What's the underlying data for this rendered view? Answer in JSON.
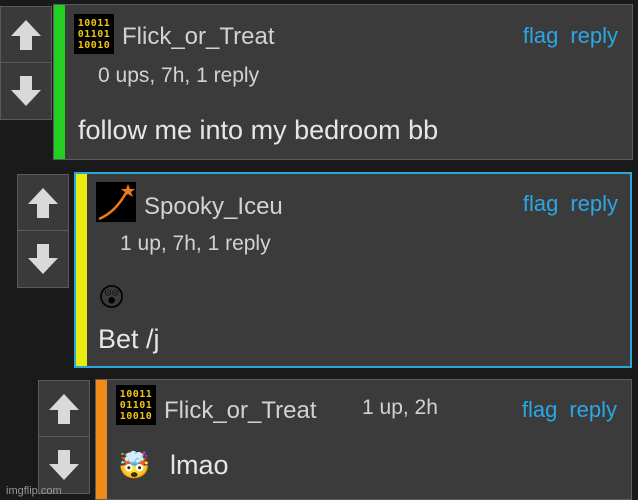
{
  "colors": {
    "accent_link": "#2aa7e6",
    "bar_green": "#22d022",
    "bar_yellow": "#e8ea10",
    "bar_orange": "#f08a1a",
    "highlight_border": "#2aa7d9"
  },
  "icons": {
    "up": "up-arrow-icon",
    "down": "down-arrow-icon"
  },
  "comments": [
    {
      "username": "Flick_or_Treat",
      "avatar_lines": [
        "10011",
        "01101",
        "10010"
      ],
      "meta": "0 ups, 7h, 1 reply",
      "flag": "flag",
      "reply": "reply",
      "emoji": "",
      "text": "follow me into my bedroom bb"
    },
    {
      "username": "Spooky_Iceu",
      "meta": "1 up, 7h, 1 reply",
      "flag": "flag",
      "reply": "reply",
      "emoji": "😲",
      "text": "Bet /j"
    },
    {
      "username": "Flick_or_Treat",
      "avatar_lines": [
        "10011",
        "01101",
        "10010"
      ],
      "meta": "1 up, 2h",
      "flag": "flag",
      "reply": "reply",
      "emoji": "🤯",
      "text": "lmao"
    }
  ],
  "watermark": "imgflip.com"
}
